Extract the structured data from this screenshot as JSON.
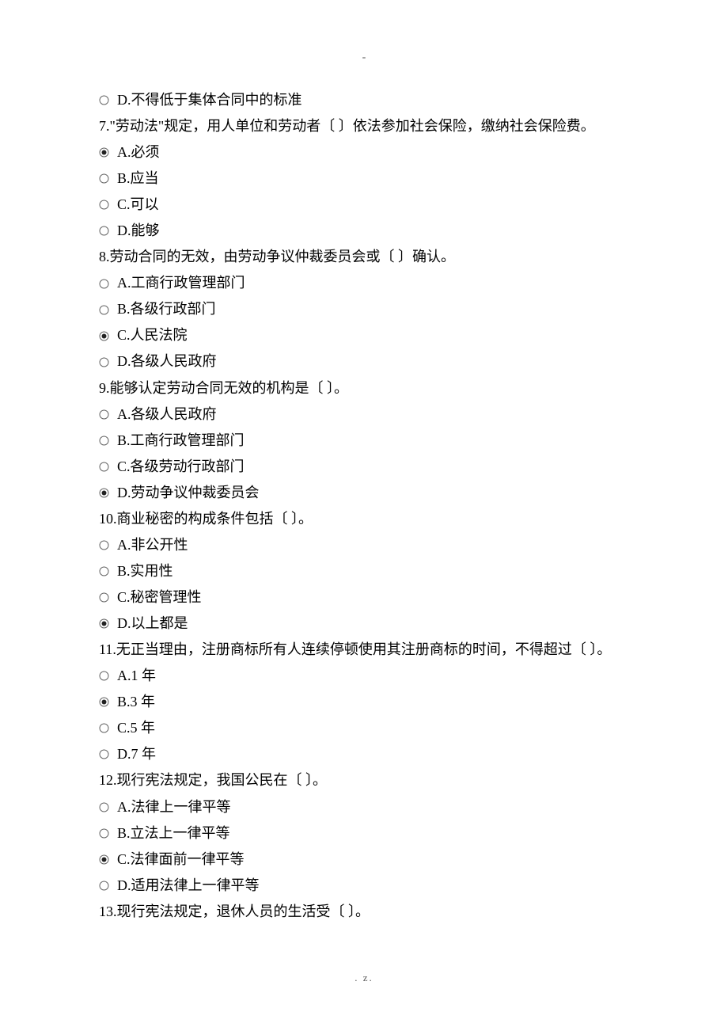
{
  "header": "-",
  "footer": ".               z.",
  "content": [
    {
      "type": "option",
      "selected": false,
      "text": "D.不得低于集体合同中的标准"
    },
    {
      "type": "question",
      "text": "7.\"劳动法\"规定，用人单位和劳动者〔    〕依法参加社会保险，缴纳社会保险费。"
    },
    {
      "type": "option",
      "selected": true,
      "text": "A.必须"
    },
    {
      "type": "option",
      "selected": false,
      "text": "B.应当"
    },
    {
      "type": "option",
      "selected": false,
      "text": "C.可以"
    },
    {
      "type": "option",
      "selected": false,
      "text": "D.能够"
    },
    {
      "type": "question",
      "text": "8.劳动合同的无效，由劳动争议仲裁委员会或〔    〕确认。"
    },
    {
      "type": "option",
      "selected": false,
      "text": "A.工商行政管理部门"
    },
    {
      "type": "option",
      "selected": false,
      "text": "B.各级行政部门"
    },
    {
      "type": "option",
      "selected": true,
      "text": "C.人民法院"
    },
    {
      "type": "option",
      "selected": false,
      "text": "D.各级人民政府"
    },
    {
      "type": "question",
      "text": "9.能够认定劳动合同无效的机构是〔    〕。"
    },
    {
      "type": "option",
      "selected": false,
      "text": "A.各级人民政府"
    },
    {
      "type": "option",
      "selected": false,
      "text": "B.工商行政管理部门"
    },
    {
      "type": "option",
      "selected": false,
      "text": "C.各级劳动行政部门"
    },
    {
      "type": "option",
      "selected": true,
      "text": "D.劳动争议仲裁委员会"
    },
    {
      "type": "question",
      "text": "10.商业秘密的构成条件包括〔    〕。"
    },
    {
      "type": "option",
      "selected": false,
      "text": "A.非公开性"
    },
    {
      "type": "option",
      "selected": false,
      "text": "B.实用性"
    },
    {
      "type": "option",
      "selected": false,
      "text": "C.秘密管理性"
    },
    {
      "type": "option",
      "selected": true,
      "text": "D.以上都是"
    },
    {
      "type": "question",
      "text": "11.无正当理由，注册商标所有人连续停顿使用其注册商标的时间，不得超过〔    〕。"
    },
    {
      "type": "option",
      "selected": false,
      "text": "A.1 年"
    },
    {
      "type": "option",
      "selected": true,
      "text": "B.3 年"
    },
    {
      "type": "option",
      "selected": false,
      "text": "C.5 年"
    },
    {
      "type": "option",
      "selected": false,
      "text": "D.7 年"
    },
    {
      "type": "question",
      "text": "12.现行宪法规定，我国公民在〔    〕。"
    },
    {
      "type": "option",
      "selected": false,
      "text": "A.法律上一律平等"
    },
    {
      "type": "option",
      "selected": false,
      "text": "B.立法上一律平等"
    },
    {
      "type": "option",
      "selected": true,
      "text": "C.法律面前一律平等"
    },
    {
      "type": "option",
      "selected": false,
      "text": "D.适用法律上一律平等"
    },
    {
      "type": "question",
      "text": "13.现行宪法规定，退休人员的生活受〔    〕。"
    }
  ]
}
